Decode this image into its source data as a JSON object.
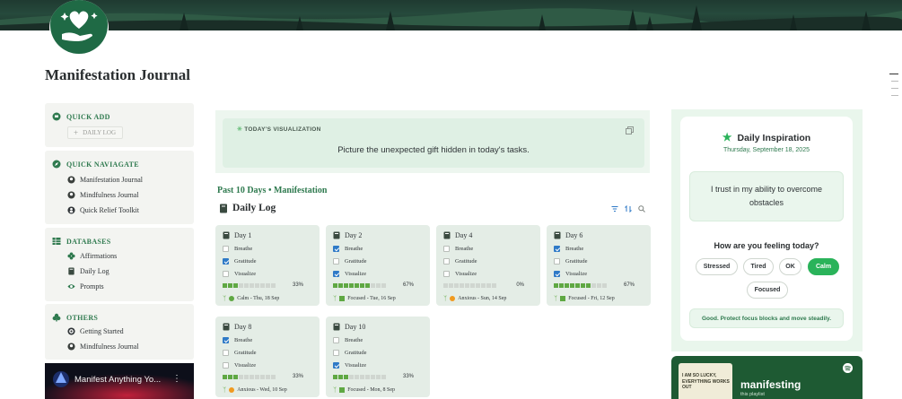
{
  "page": {
    "title": "Manifestation Journal"
  },
  "sidebar": {
    "quick_add": {
      "heading": "QUICK ADD",
      "button_label": "DAILY LOG"
    },
    "quick_navigate": {
      "heading": "QUICK NAVIAGATE",
      "items": [
        {
          "label": "Manifestation Journal",
          "icon": "mind-icon"
        },
        {
          "label": "Mindfulness Journal",
          "icon": "mind-icon"
        },
        {
          "label": "Quick Relief Toolkit",
          "icon": "person-icon"
        }
      ]
    },
    "databases": {
      "heading": "DATABASES",
      "items": [
        {
          "label": "Affirmations",
          "icon": "flower-icon"
        },
        {
          "label": "Daily Log",
          "icon": "book-icon"
        },
        {
          "label": "Prompts",
          "icon": "eye-icon"
        }
      ]
    },
    "others": {
      "heading": "OTHERS",
      "items": [
        {
          "label": "Getting Started",
          "icon": "target-icon"
        },
        {
          "label": "Mindfulness Journal",
          "icon": "mind-icon"
        }
      ]
    },
    "video": {
      "title": "Manifest Anything Yo..."
    }
  },
  "visualization": {
    "label": "TODAY'S VISUALIZATION",
    "text": "Picture the unexpected gift hidden in today's tasks."
  },
  "daily_log": {
    "subheading": "Past 10 Days • Manifestation",
    "title": "Daily Log",
    "cards": [
      {
        "title": "Day 1",
        "breathe": false,
        "gratitude": true,
        "visualize": false,
        "progress": 0.33,
        "pct": "33%",
        "mood": "Calm - Thu, 18 Sep",
        "mood_color": "#5fa843",
        "mood_shape": "dot"
      },
      {
        "title": "Day 2",
        "breathe": true,
        "gratitude": false,
        "visualize": true,
        "progress": 0.67,
        "pct": "67%",
        "mood": "Focused - Tue, 16 Sep",
        "mood_color": "#5fa843",
        "mood_shape": "sq"
      },
      {
        "title": "Day 4",
        "breathe": false,
        "gratitude": false,
        "visualize": false,
        "progress": 0,
        "pct": "0%",
        "mood": "Anxious - Sun, 14 Sep",
        "mood_color": "#f09a20",
        "mood_shape": "dot"
      },
      {
        "title": "Day 6",
        "breathe": true,
        "gratitude": false,
        "visualize": true,
        "progress": 0.67,
        "pct": "67%",
        "mood": "Focused - Fri, 12 Sep",
        "mood_color": "#5fa843",
        "mood_shape": "sq"
      },
      {
        "title": "Day 8",
        "breathe": true,
        "gratitude": false,
        "visualize": false,
        "progress": 0.33,
        "pct": "33%",
        "mood": "Anxious - Wed, 10 Sep",
        "mood_color": "#f09a20",
        "mood_shape": "dot"
      },
      {
        "title": "Day 10",
        "breathe": false,
        "gratitude": false,
        "visualize": true,
        "progress": 0.33,
        "pct": "33%",
        "mood": "Focused - Mon, 8 Sep",
        "mood_color": "#5fa843",
        "mood_shape": "sq"
      }
    ],
    "labels": {
      "breathe": "Breathe",
      "gratitude": "Gratitude",
      "visualize": "Visualize"
    }
  },
  "inspiration": {
    "title": "Daily Inspiration",
    "date": "Thursday, September 18, 2025",
    "quote": "I trust in my ability to overcome obstacles",
    "question": "How are you feeling today?",
    "moods": [
      "Stressed",
      "Tired",
      "OK",
      "Calm",
      "Focused"
    ],
    "selected_mood": "Calm",
    "advice": "Good. Protect focus blocks and move steadily."
  },
  "spotify": {
    "cover_text": "I AM SO LUCKY, EVERYTHING WORKS OUT",
    "title": "manifesting",
    "subtitle": "this playlist"
  },
  "colors": {
    "accent": "#2f7a4f",
    "selected_pill": "#2ab35a",
    "progress_fill": "#5fa843",
    "checkbox": "#2f7ac7"
  }
}
